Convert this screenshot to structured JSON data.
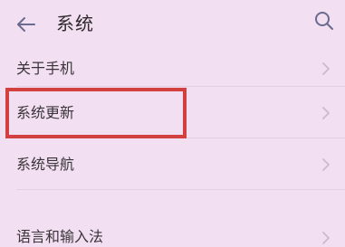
{
  "header": {
    "title": "系统",
    "back_icon": "arrow-left-icon",
    "search_icon": "search-icon"
  },
  "settings_items": [
    {
      "label": "关于手机",
      "icon": "chevron-right-icon"
    },
    {
      "label": "系统更新",
      "icon": "chevron-right-icon",
      "highlighted": true
    },
    {
      "label": "系统导航",
      "icon": "chevron-right-icon"
    },
    {
      "label": "语言和输入法",
      "icon": "chevron-right-icon"
    }
  ],
  "colors": {
    "background": "#f2dff1",
    "highlight_border": "#d24140",
    "icon": "#6b6a8f",
    "chevron": "#cdb9cc"
  }
}
